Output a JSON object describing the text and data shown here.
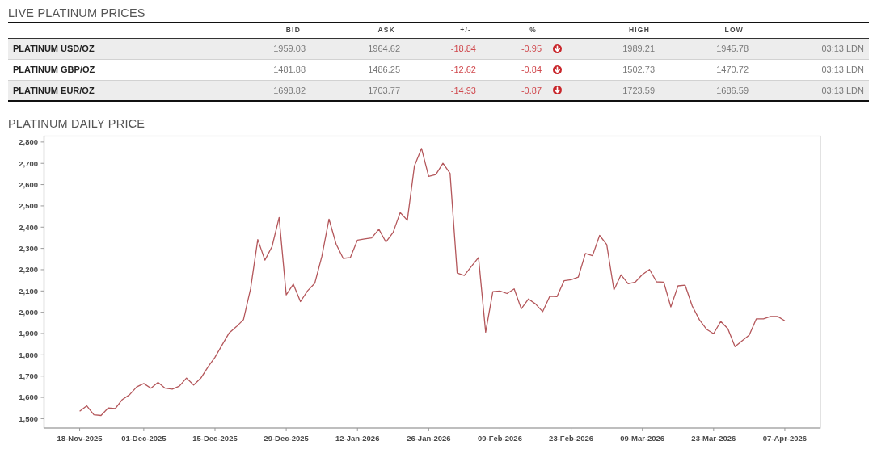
{
  "prices": {
    "title": "LIVE PLATINUM PRICES",
    "columns": [
      "BID",
      "ASK",
      "+/-",
      "%",
      "HIGH",
      "LOW"
    ],
    "rows": [
      {
        "name": "PLATINUM USD/OZ",
        "bid": "1959.03",
        "ask": "1964.62",
        "change": "-18.84",
        "percent": "-0.95",
        "down": true,
        "high": "1989.21",
        "low": "1945.78",
        "time": "03:13 LDN"
      },
      {
        "name": "PLATINUM GBP/OZ",
        "bid": "1481.88",
        "ask": "1486.25",
        "change": "-12.62",
        "percent": "-0.84",
        "down": true,
        "high": "1502.73",
        "low": "1470.72",
        "time": "03:13 LDN"
      },
      {
        "name": "PLATINUM EUR/OZ",
        "bid": "1698.82",
        "ask": "1703.77",
        "change": "-14.93",
        "percent": "-0.87",
        "down": true,
        "high": "1723.59",
        "low": "1686.59",
        "time": "03:13 LDN"
      }
    ]
  },
  "chart": {
    "title": "PLATINUM DAILY PRICE",
    "chart_data": {
      "type": "line",
      "categories": [
        "18-Nov-2025",
        null,
        null,
        null,
        null,
        null,
        null,
        null,
        null,
        "01-Dec-2025",
        null,
        null,
        null,
        null,
        null,
        null,
        null,
        null,
        null,
        "15-Dec-2025",
        null,
        null,
        null,
        null,
        null,
        null,
        null,
        null,
        null,
        "29-Dec-2025",
        null,
        null,
        null,
        null,
        null,
        null,
        null,
        null,
        null,
        "12-Jan-2026",
        null,
        null,
        null,
        null,
        null,
        null,
        null,
        null,
        null,
        "26-Jan-2026",
        null,
        null,
        null,
        null,
        null,
        null,
        null,
        null,
        null,
        "09-Feb-2026",
        null,
        null,
        null,
        null,
        null,
        null,
        null,
        null,
        null,
        "23-Feb-2026",
        null,
        null,
        null,
        null,
        null,
        null,
        null,
        null,
        null,
        "09-Mar-2026",
        null,
        null,
        null,
        null,
        null,
        null,
        null,
        null,
        null,
        "23-Mar-2026",
        null,
        null,
        null,
        null,
        null,
        null,
        null,
        null,
        null,
        "07-Apr-2026"
      ],
      "series": [
        {
          "color": "#b4575b",
          "values": [
            1535,
            1560,
            1518,
            1515,
            1550,
            1547,
            1590,
            1612,
            1649,
            1665,
            1643,
            1670,
            1643,
            1639,
            1653,
            1691,
            1658,
            1690,
            1742,
            1789,
            1846,
            1903,
            1932,
            1965,
            2110,
            2342,
            2245,
            2308,
            2445,
            2082,
            2132,
            2050,
            2101,
            2136,
            2263,
            2438,
            2320,
            2253,
            2257,
            2339,
            2345,
            2349,
            2390,
            2330,
            2375,
            2469,
            2432,
            2688,
            2770,
            2639,
            2647,
            2700,
            2653,
            2184,
            2173,
            2216,
            2257,
            1906,
            2097,
            2100,
            2088,
            2110,
            2016,
            2062,
            2039,
            2003,
            2075,
            2073,
            2148,
            2153,
            2165,
            2276,
            2266,
            2361,
            2318,
            2105,
            2176,
            2134,
            2142,
            2177,
            2201,
            2143,
            2142,
            2025,
            2124,
            2127,
            2029,
            1965,
            1920,
            1899,
            1957,
            1923,
            1838,
            1866,
            1892,
            1969,
            1969,
            1980,
            1980,
            1960
          ]
        }
      ],
      "ylim": [
        1456,
        2828
      ],
      "yticks": [
        {
          "value": 1500,
          "label": "1,500"
        },
        {
          "value": 1600,
          "label": "1,600"
        },
        {
          "value": 1700,
          "label": "1,700"
        },
        {
          "value": 1800,
          "label": "1,800"
        },
        {
          "value": 1900,
          "label": "1,900"
        },
        {
          "value": 2000,
          "label": "2,000"
        },
        {
          "value": 2100,
          "label": "2,100"
        },
        {
          "value": 2200,
          "label": "2,200"
        },
        {
          "value": 2300,
          "label": "2,300"
        },
        {
          "value": 2400,
          "label": "2,400"
        },
        {
          "value": 2500,
          "label": "2,500"
        },
        {
          "value": 2600,
          "label": "2,600"
        },
        {
          "value": 2700,
          "label": "2,700"
        },
        {
          "value": 2800,
          "label": "2,800"
        }
      ]
    }
  }
}
